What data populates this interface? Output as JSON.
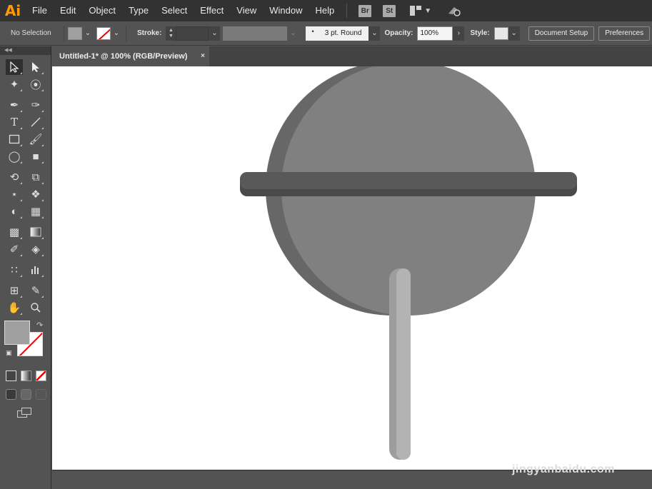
{
  "app": {
    "logo": "Ai"
  },
  "menu": {
    "items": [
      "File",
      "Edit",
      "Object",
      "Type",
      "Select",
      "Effect",
      "View",
      "Window",
      "Help"
    ],
    "badges": [
      "Br",
      "St"
    ]
  },
  "control": {
    "selection": "No Selection",
    "stroke_label": "Stroke:",
    "profile": "3 pt. Round",
    "opacity_label": "Opacity:",
    "opacity_value": "100%",
    "style_label": "Style:",
    "document_setup": "Document Setup",
    "preferences": "Preferences"
  },
  "document": {
    "tab_title": "Untitled-1* @ 100% (RGB/Preview)",
    "close_glyph": "×"
  },
  "artwork": {
    "circle_shadow_color": "#676767",
    "circle_color": "#808080",
    "bar_color": "#595959",
    "bar_shadow_color": "#4a4a4a",
    "stick_color": "#b3b3b3",
    "stick_shadow_color": "#9d9d9d"
  },
  "watermark": "jingyanbaidu.com",
  "colors": {
    "menubar": "#323232",
    "panel": "#535353",
    "accent_logo": "#ff9a00"
  },
  "icons": {
    "toolbox": [
      "selection-tool-icon",
      "direct-selection-tool-icon",
      "magic-wand-icon",
      "lasso-icon",
      "pen-icon",
      "curvature-icon",
      "type-icon",
      "line-icon",
      "rectangle-icon",
      "paintbrush-icon",
      "shaper-icon",
      "eraser-icon",
      "rotate-icon",
      "scale-icon",
      "width-icon",
      "puppet-warp-icon",
      "shape-builder-icon",
      "perspective-grid-icon",
      "mesh-icon",
      "gradient-icon",
      "eyedropper-icon",
      "blend-icon",
      "symbol-sprayer-icon",
      "column-graph-icon",
      "artboard-icon",
      "slice-icon",
      "hand-icon",
      "zoom-icon"
    ]
  }
}
